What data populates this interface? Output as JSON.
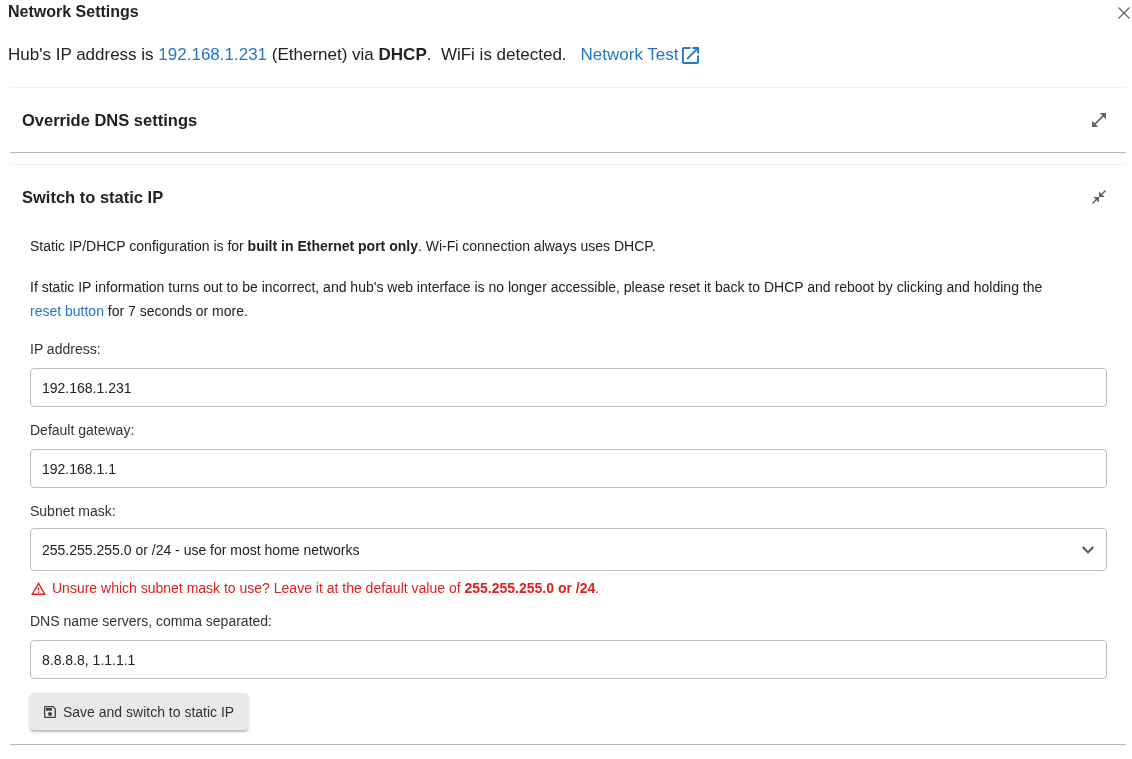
{
  "dialog": {
    "title": "Network Settings"
  },
  "status": {
    "prefix": "Hub's IP address is ",
    "ip_link": "192.168.1.231",
    "suffix": " (Ethernet) via **DHCP**.  WiFi is detected.",
    "test_link": "Network Test"
  },
  "sections": [
    {
      "title": "Override DNS settings",
      "expanded": false
    },
    {
      "title": "Switch to static IP",
      "expanded": true,
      "paragraphs": [
        {
          "text": "Static IP/DHCP configuration is for **built in Ethernet port only**. Wi-Fi connection always uses DHCP."
        },
        {
          "text": "If static IP information turns out to be incorrect, and hub's web interface is no longer accessible, please reset it back to DHCP and reboot by clicking and holding the ",
          "link": "reset button",
          "after": " for 7 seconds or more."
        }
      ],
      "fields": [
        {
          "kind": "text",
          "label": "IP address:",
          "value": "192.168.1.231"
        },
        {
          "kind": "text",
          "label": "Default gateway:",
          "value": "192.168.1.1"
        },
        {
          "kind": "select",
          "label": "Subnet mask:",
          "value": "255.255.255.0 or /24 - use for most home networks",
          "warning": "Unsure which subnet mask to use? Leave it at the default value of **255.255.255.0 or /24**."
        },
        {
          "kind": "text",
          "label": "DNS name servers, comma separated:",
          "value": "8.8.8.8, 1.1.1.1"
        }
      ],
      "button": {
        "label": "Save and switch to static IP"
      }
    }
  ]
}
